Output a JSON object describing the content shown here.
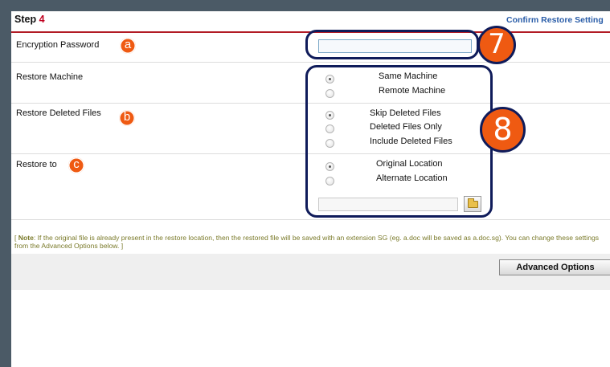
{
  "step": {
    "label": "Step",
    "number": "4"
  },
  "header": {
    "confirm_link": "Confirm Restore Setting"
  },
  "rows": {
    "encryption": {
      "label": "Encryption Password",
      "badge": "a"
    },
    "machine": {
      "label": "Restore Machine"
    },
    "deleted": {
      "label": "Restore Deleted Files",
      "badge": "b"
    },
    "restore_to": {
      "label": "Restore to",
      "badge": "c"
    }
  },
  "options": {
    "machine": [
      {
        "label": "Same Machine",
        "selected": true
      },
      {
        "label": "Remote Machine",
        "selected": false
      }
    ],
    "deleted": [
      {
        "label": "Skip Deleted Files",
        "selected": true
      },
      {
        "label": "Deleted Files Only",
        "selected": false
      },
      {
        "label": "Include Deleted Files",
        "selected": false
      }
    ],
    "location": [
      {
        "label": "Original Location",
        "selected": true
      },
      {
        "label": "Alternate Location",
        "selected": false
      }
    ]
  },
  "callouts": {
    "seven": "7",
    "eight": "8"
  },
  "note": {
    "prefix": "[ ",
    "bold": "Note",
    "text": ": If the original file is already present in the restore location, then the restored file will be saved with an extension SG (eg. a.doc will be saved as a.doc.sg). You can change these settings from the Advanced Options below. ]"
  },
  "buttons": {
    "advanced": "Advanced Options"
  },
  "colors": {
    "accent_red": "#b21b25",
    "badge_orange": "#ef5a12",
    "callout_navy": "#0f1b5a",
    "link_blue": "#2a5da8"
  }
}
